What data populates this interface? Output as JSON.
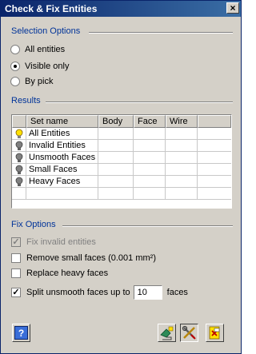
{
  "window": {
    "title": "Check & Fix Entities",
    "close_glyph": "×"
  },
  "selection": {
    "header": "Selection Options",
    "options": [
      {
        "label": "All entities",
        "selected": false
      },
      {
        "label": "Visible only",
        "selected": true
      },
      {
        "label": "By pick",
        "selected": false
      }
    ]
  },
  "results": {
    "header": "Results",
    "columns": [
      "Set name",
      "Body",
      "Face",
      "Wire"
    ],
    "rows": [
      {
        "name": "All Entities",
        "bulb": "yellow"
      },
      {
        "name": "Invalid Entities",
        "bulb": "gray"
      },
      {
        "name": "Unsmooth Faces",
        "bulb": "gray"
      },
      {
        "name": "Small Faces",
        "bulb": "gray"
      },
      {
        "name": "Heavy Faces",
        "bulb": "gray"
      }
    ]
  },
  "fix": {
    "header": "Fix Options",
    "fix_invalid": {
      "label": "Fix invalid entities",
      "checked": true,
      "enabled": false
    },
    "remove_small": {
      "label": "Remove small faces  (0.001 mm²)",
      "checked": false
    },
    "replace_heavy": {
      "label": "Replace heavy faces",
      "checked": false
    },
    "split_unsmooth": {
      "label": "Split unsmooth faces up to",
      "checked": true,
      "value": "10",
      "unit": "faces"
    }
  },
  "buttons": {
    "help_icon": "help-icon",
    "check_icon": "check-run-icon",
    "fix_icon": "fix-tools-icon",
    "close_icon": "close-exit-icon"
  },
  "colors": {
    "title_start": "#0a246a",
    "section_text": "#003399",
    "bulb_on": "#ffe000",
    "bulb_off": "#808080"
  }
}
